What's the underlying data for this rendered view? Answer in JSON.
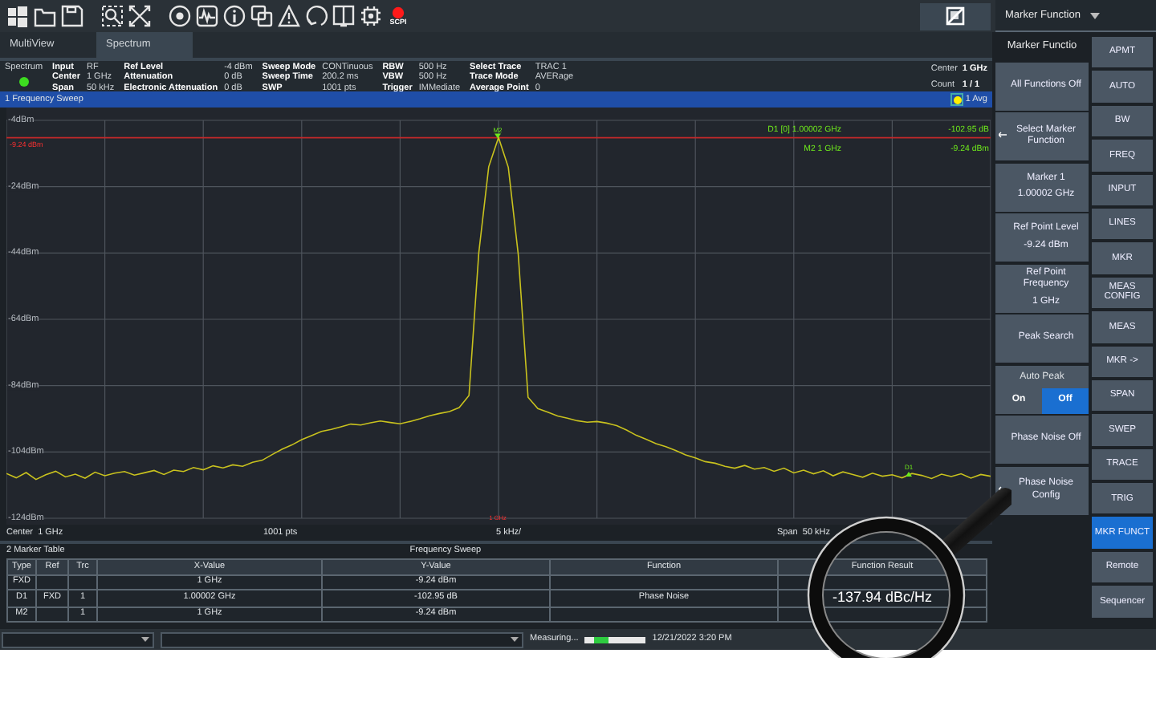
{
  "toolbar": {
    "scpi_label": "SCPI",
    "menu_title": "Marker Function"
  },
  "tabs": [
    {
      "label": "MultiView",
      "selected": false
    },
    {
      "label": "Spectrum",
      "selected": true
    }
  ],
  "header": {
    "channel": "Spectrum",
    "groups": [
      [
        {
          "label": "Input",
          "value": "RF"
        },
        {
          "label": "Center",
          "value": "1 GHz"
        },
        {
          "label": "Span",
          "value": "50 kHz"
        }
      ],
      [
        {
          "label": "Ref Level",
          "value": "-4 dBm"
        },
        {
          "label": "Attenuation",
          "value": "0 dB"
        },
        {
          "label": "Electronic Attenuation",
          "value": "0 dB"
        }
      ],
      [
        {
          "label": "Sweep Mode",
          "value": "CONTinuous"
        },
        {
          "label": "Sweep Time",
          "value": "200.2 ms"
        },
        {
          "label": "SWP",
          "value": "1001 pts"
        }
      ],
      [
        {
          "label": "RBW",
          "value": "500 Hz"
        },
        {
          "label": "VBW",
          "value": "500 Hz"
        },
        {
          "label": "Trigger",
          "value": "IMMediate"
        }
      ],
      [
        {
          "label": "Select Trace",
          "value": "TRAC 1"
        },
        {
          "label": "Trace Mode",
          "value": "AVERage"
        },
        {
          "label": "Average Point",
          "value": "0"
        }
      ]
    ],
    "right": [
      {
        "label": "Center",
        "value": "1 GHz"
      },
      {
        "label": "Count",
        "value": "1 / 1"
      }
    ]
  },
  "sweep_window": {
    "title": "1  Frequency Sweep",
    "trace_badge": "1 Avg",
    "chart_data": {
      "type": "line",
      "ylim": [
        -124,
        -4
      ],
      "grid": true,
      "ref_lines": [
        {
          "axis": "y",
          "value": -9.24,
          "label": "-9.24 dBm",
          "color": "#c0282a"
        }
      ],
      "yticks": [
        {
          "value": -4,
          "label": "-4dBm"
        },
        {
          "value": -24,
          "label": "-24dBm"
        },
        {
          "value": -44,
          "label": "-44dBm"
        },
        {
          "value": -64,
          "label": "-64dBm"
        },
        {
          "value": -84,
          "label": "-84dBm"
        },
        {
          "value": -104,
          "label": "-104dBm"
        },
        {
          "value": -124,
          "label": "-124dBm"
        }
      ],
      "categories": [
        null,
        null,
        null,
        null,
        null,
        null,
        null,
        null,
        null,
        null,
        null,
        null,
        null,
        null,
        null,
        null,
        null,
        null,
        null,
        null,
        null,
        null,
        null,
        null,
        null,
        null,
        null,
        null,
        null,
        null,
        null,
        null,
        null,
        null,
        null,
        null,
        null,
        null,
        null,
        null,
        null,
        null,
        null,
        null,
        null,
        null,
        null,
        null,
        null,
        null,
        null,
        null,
        null,
        null,
        null,
        null,
        null,
        null,
        null,
        null,
        null,
        null,
        null,
        null,
        null,
        null,
        null,
        null,
        null,
        null,
        null,
        null,
        null,
        null,
        null,
        null,
        null,
        null,
        null,
        null,
        null,
        null,
        null,
        null,
        null,
        null,
        null,
        null,
        null,
        null,
        null,
        null,
        null,
        null,
        null,
        null,
        null,
        null,
        null,
        null,
        null
      ],
      "series": [
        {
          "color": "#c9c21e",
          "values": [
            -110.5,
            -111.8,
            -110.2,
            -112.3,
            -110.9,
            -109.8,
            -111.5,
            -110.7,
            -111.9,
            -110.1,
            -111.2,
            -110.4,
            -109.9,
            -111.0,
            -110.3,
            -109.6,
            -110.8,
            -109.5,
            -109.9,
            -108.7,
            -109.4,
            -108.2,
            -108.8,
            -107.9,
            -108.3,
            -107.1,
            -106.5,
            -104.8,
            -103.2,
            -101.9,
            -100.3,
            -99.1,
            -97.8,
            -97.2,
            -96.4,
            -95.6,
            -95.9,
            -95.2,
            -94.7,
            -95.1,
            -95.5,
            -94.8,
            -94.0,
            -93.1,
            -92.4,
            -91.8,
            -90.6,
            -87.0,
            -44.0,
            -18.0,
            -9.2,
            -18.2,
            -44.5,
            -87.5,
            -90.9,
            -92.0,
            -93.2,
            -93.8,
            -94.6,
            -95.0,
            -94.8,
            -95.3,
            -96.1,
            -97.4,
            -99.0,
            -100.2,
            -101.5,
            -102.4,
            -103.6,
            -104.9,
            -105.8,
            -106.9,
            -107.4,
            -108.3,
            -108.9,
            -108.1,
            -109.2,
            -108.7,
            -109.8,
            -108.9,
            -110.3,
            -109.5,
            -110.6,
            -109.7,
            -111.2,
            -110.0,
            -110.8,
            -111.6,
            -110.4,
            -111.3,
            -110.9,
            -111.8,
            -110.5,
            -111.1,
            -112.0,
            -110.7,
            -111.4,
            -110.6,
            -111.9,
            -110.8,
            -111.3
          ]
        }
      ]
    },
    "center_tick_label": "1 GHz",
    "markers": [
      {
        "kind": "peak",
        "label": "M2"
      },
      {
        "kind": "delta",
        "label": "D1"
      }
    ],
    "readouts": [
      {
        "name": "D1 [0]",
        "x": "1.00002 GHz",
        "y": "-102.95 dB"
      },
      {
        "name": "M2",
        "x": "1 GHz",
        "y": "-9.24 dBm"
      }
    ],
    "footer": [
      "Center  1 GHz",
      "1001 pts",
      "5 kHz/",
      "Span  50 kHz"
    ]
  },
  "marker_table": {
    "title": "2  Marker Table",
    "subtitle": "Frequency Sweep",
    "columns": [
      "Type",
      "Ref",
      "Trc",
      "X-Value",
      "Y-Value",
      "Function",
      "Function Result"
    ],
    "rows": [
      [
        "FXD",
        "",
        "",
        "1 GHz",
        "-9.24 dBm",
        "",
        ""
      ],
      [
        "D1",
        "FXD",
        "1",
        "1.00002 GHz",
        "-102.95 dB",
        "Phase Noise",
        "-137.94 dBc/Hz"
      ],
      [
        "M2",
        "",
        "1",
        "1 GHz",
        "-9.24 dBm",
        "",
        ""
      ]
    ]
  },
  "softkeys": {
    "title": "Marker Functio",
    "keys": [
      {
        "kind": "button",
        "label": "All Functions Off",
        "submenu": false
      },
      {
        "kind": "button",
        "label": "Select Marker Function",
        "submenu": true
      },
      {
        "kind": "value",
        "label": "Marker 1",
        "value": "1.00002 GHz"
      },
      {
        "kind": "value",
        "label": "Ref Point Level",
        "value": "-9.24 dBm"
      },
      {
        "kind": "value",
        "label": "Ref Point Frequency",
        "value": "1 GHz"
      },
      {
        "kind": "button",
        "label": "Peak Search",
        "submenu": false
      },
      {
        "kind": "toggle",
        "label": "Auto Peak",
        "options": [
          {
            "label": "On",
            "selected": false
          },
          {
            "label": "Off",
            "selected": true
          }
        ]
      },
      {
        "kind": "button",
        "label": "Phase Noise Off",
        "submenu": false
      },
      {
        "kind": "button",
        "label": "Phase Noise Config",
        "submenu": true
      }
    ]
  },
  "hardkeys": [
    {
      "label": "APMT",
      "selected": false
    },
    {
      "label": "AUTO",
      "selected": false
    },
    {
      "label": "BW",
      "selected": false
    },
    {
      "label": "FREQ",
      "selected": false
    },
    {
      "label": "INPUT",
      "selected": false
    },
    {
      "label": "LINES",
      "selected": false
    },
    {
      "label": "MKR",
      "selected": false
    },
    {
      "label": "MEAS CONFIG",
      "selected": false
    },
    {
      "label": "MEAS",
      "selected": false
    },
    {
      "label": "MKR ->",
      "selected": false
    },
    {
      "label": "SPAN",
      "selected": false
    },
    {
      "label": "SWEP",
      "selected": false
    },
    {
      "label": "TRACE",
      "selected": false
    },
    {
      "label": "TRIG",
      "selected": false
    },
    {
      "label": "MKR FUNCT",
      "selected": true
    },
    {
      "label": "Remote",
      "selected": false
    },
    {
      "label": "Sequencer",
      "selected": false
    }
  ],
  "status_bar": {
    "message": "Measuring...",
    "datetime": "12/21/2022 3:20 PM"
  }
}
